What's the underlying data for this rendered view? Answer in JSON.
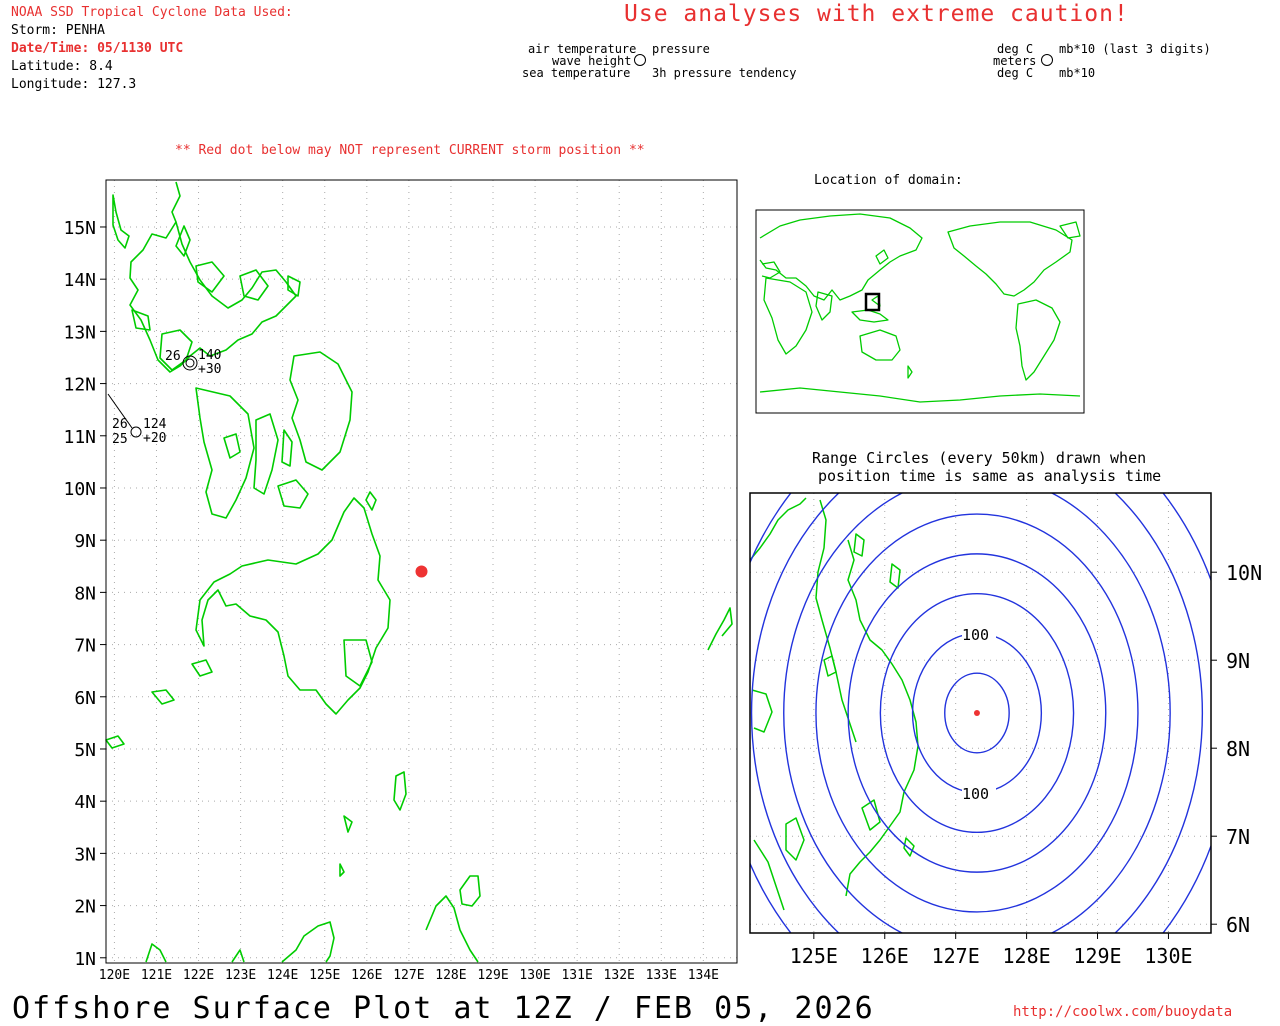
{
  "header": {
    "source_line": "NOAA SSD Tropical Cyclone Data Used:",
    "storm": "Storm: PENHA",
    "datetime": "Date/Time: 05/1130 UTC",
    "latitude": "Latitude: 8.4",
    "longitude": "Longitude: 127.3",
    "caution": "Use analyses with extreme caution!"
  },
  "legend": {
    "left": {
      "air_temperature": "air temperature",
      "wave_height": "wave height",
      "sea_temperature": "sea temperature",
      "pressure": "pressure",
      "pressure_tendency": "3h pressure tendency"
    },
    "right": {
      "deg_c_top": "deg C",
      "meters": "meters",
      "deg_c_bottom": "deg C",
      "mb_top": "mb*10 (last 3 digits)",
      "mb_bottom": "mb*10"
    }
  },
  "red_dot_warning": "** Red dot below may NOT represent CURRENT storm position **",
  "main_map": {
    "lat_labels": [
      "15N",
      "14N",
      "13N",
      "12N",
      "11N",
      "10N",
      "9N",
      "8N",
      "7N",
      "6N",
      "5N",
      "4N",
      "3N",
      "2N",
      "1N"
    ],
    "lon_labels": [
      "120E",
      "121E",
      "122E",
      "123E",
      "124E",
      "125E",
      "126E",
      "127E",
      "128E",
      "129E",
      "130E",
      "131E",
      "132E",
      "133E",
      "134E"
    ],
    "storm_position": {
      "lat": 8.4,
      "lon": 127.3
    },
    "observations": [
      {
        "air_temp": "26",
        "pressure": "140",
        "tendency": "+30"
      },
      {
        "air_temp": "26",
        "sea_temp": "25",
        "pressure": "124",
        "tendency": "+20"
      }
    ]
  },
  "inset": {
    "title": "Location of domain:"
  },
  "range_panel": {
    "title_line1": "Range Circles (every 50km) drawn when",
    "title_line2": "position time is same as analysis time",
    "lat_labels": [
      "10N",
      "9N",
      "8N",
      "7N",
      "6N"
    ],
    "lon_labels": [
      "125E",
      "126E",
      "127E",
      "128E",
      "129E",
      "130E"
    ],
    "circle_labels": [
      "100",
      "100"
    ],
    "circle_interval_km": 50
  },
  "footer": {
    "title": "Offshore Surface Plot at 12Z / FEB 05, 2026",
    "url": "http://coolwx.com/buoydata"
  },
  "colors": {
    "land": "#00cc00",
    "storm": "#ee3333",
    "range_circles": "#2233dd",
    "header_red": "#e83030"
  }
}
